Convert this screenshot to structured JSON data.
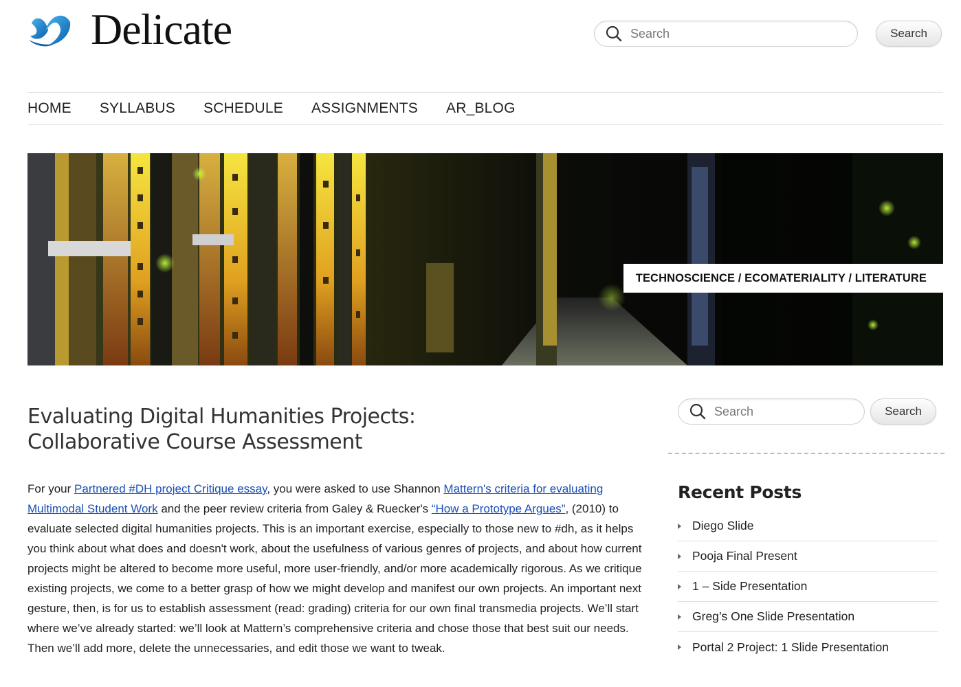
{
  "site": {
    "title": "Delicate",
    "logo_icon": "butterfly-icon"
  },
  "header_search": {
    "placeholder": "Search",
    "button_label": "Search"
  },
  "nav": {
    "items": [
      "HOME",
      "SYLLABUS",
      "SCHEDULE",
      "ASSIGNMENTS",
      "AR_BLOG"
    ]
  },
  "banner": {
    "tagline": "TECHNOSCIENCE / ECOMATERIALITY / LITERATURE"
  },
  "post": {
    "title_line1": "Evaluating Digital Humanities Projects:",
    "title_line2": "Collaborative Course Assessment",
    "body": {
      "t1": "For your ",
      "link1": "Partnered #DH project Critique essay",
      "t2": ", you were asked to use Shannon ",
      "link2": "Mattern's criteria for evaluating Multimodal Student Work",
      "t3": " and the peer review criteria from Galey & Ruecker's ",
      "link3": "“How a Prototype Argues”",
      "t4": ", (2010) to evaluate selected digital humanities projects. This is an important exercise, especially to those new to #dh, as it helps you think about what does and doesn't work, about the usefulness of various genres of projects, and about how current projects might be altered to become more useful, more user-friendly, and/or more academically rigorous. As we critique existing projects, we come to a better grasp of how we might develop and manifest our own projects. An important next gesture, then, is for us to establish assessment (read: grading) criteria for our own final transmedia projects. We’ll start where we’ve already started: we’ll look at Mattern’s comprehensive criteria and chose those that best suit our needs. Then we’ll add more, delete the unnecessaries, and edit those we want to tweak."
    }
  },
  "sidebar": {
    "search": {
      "placeholder": "Search",
      "button_label": "Search"
    },
    "recent_title": "Recent Posts",
    "recent_posts": [
      "Diego Slide",
      "Pooja Final Present",
      "1 – Side Presentation",
      "Greg’s One Slide Presentation",
      "Portal 2 Project: 1 Slide Presentation"
    ]
  },
  "colors": {
    "link": "#1a4fb5",
    "logo_blue": "#1e90d6"
  }
}
